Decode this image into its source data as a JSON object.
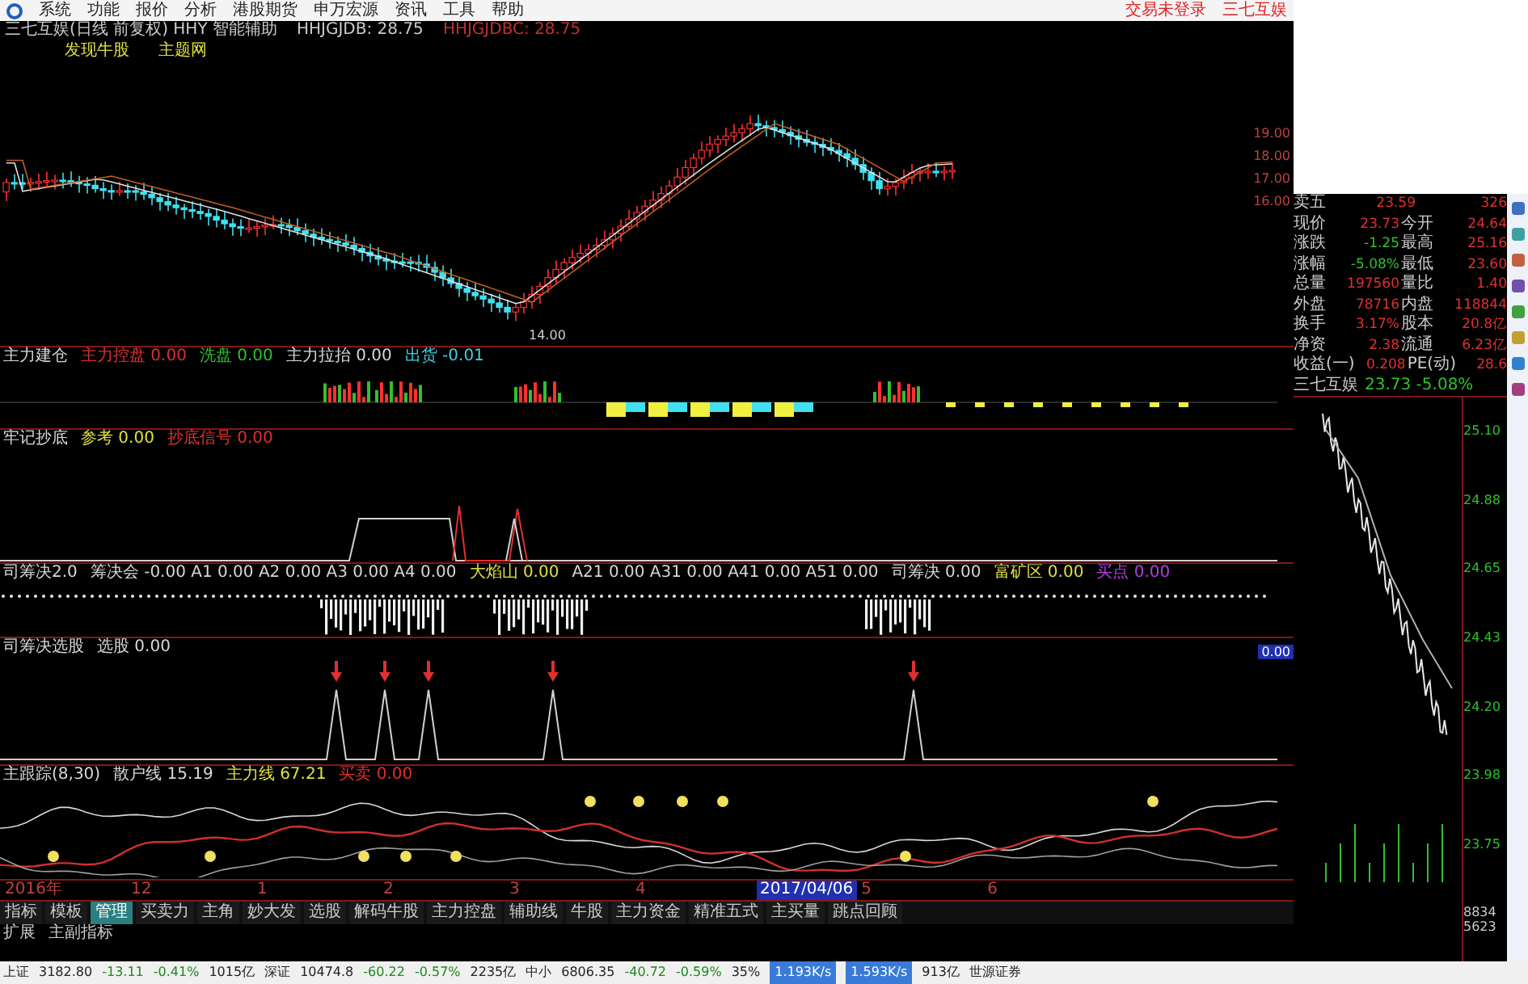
{
  "menu": {
    "items": [
      "系统",
      "功能",
      "报价",
      "分析",
      "港股期货",
      "申万宏源",
      "资讯",
      "工具",
      "帮助"
    ],
    "right_links": [
      "交易未登录",
      "三七互娱"
    ]
  },
  "chart_header": {
    "title": "三七互娱(日线 前复权) HHY 智能辅助",
    "indicator": "HHJGJDB: 28.75",
    "indicator_alt": "HHJGJDBC: 28.75"
  },
  "buttons": [
    "发现牛股",
    "主题网"
  ],
  "main_chart": {
    "low_label": "14.00",
    "price_labels": [
      "19.00",
      "18.00",
      "17.00",
      "16.00"
    ]
  },
  "panels": [
    {
      "labels": [
        {
          "text": "主力建仓",
          "color": "#d8d8d8"
        },
        {
          "text": "主力控盘 0.00",
          "color": "#e03030"
        },
        {
          "text": "洗盘 0.00",
          "color": "#30c030"
        },
        {
          "text": "主力拉抬 0.00",
          "color": "#d8d8d8"
        },
        {
          "text": "出货 -0.01",
          "color": "#40d0e0"
        }
      ]
    },
    {
      "labels": [
        {
          "text": "牢记抄底",
          "color": "#d8d8d8"
        },
        {
          "text": "参考 0.00",
          "color": "#e0e040"
        },
        {
          "text": "抄底信号 0.00",
          "color": "#e03030"
        }
      ]
    },
    {
      "labels": [
        {
          "text": "司筹决2.0",
          "color": "#d8d8d8"
        },
        {
          "text": "筹决会 -0.00 A1 0.00 A2 0.00 A3 0.00 A4 0.00",
          "color": "#d8d8d8"
        },
        {
          "text": "大焰山 0.00",
          "color": "#e0e040"
        },
        {
          "text": "A21 0.00 A31 0.00 A41 0.00 A51 0.00",
          "color": "#d8d8d8"
        },
        {
          "text": "司筹决 0.00",
          "color": "#d8d8d8"
        },
        {
          "text": "富矿区 0.00",
          "color": "#e0e040"
        },
        {
          "text": "买点 0.00",
          "color": "#b040e0"
        }
      ]
    },
    {
      "labels": [
        {
          "text": "司筹决选股",
          "color": "#d8d8d8"
        },
        {
          "text": "选股 0.00",
          "color": "#d8d8d8"
        }
      ]
    },
    {
      "labels": [
        {
          "text": "主跟踪(8,30)",
          "color": "#d8d8d8"
        },
        {
          "text": "散户线 15.19",
          "color": "#d8d8d8"
        },
        {
          "text": "主力线 67.21",
          "color": "#e0e040"
        },
        {
          "text": "买卖 0.00",
          "color": "#e03030"
        }
      ]
    }
  ],
  "side_badge": "0.00",
  "quote": {
    "rows": [
      {
        "label": "卖五",
        "value": "23.59",
        "value2": "326"
      },
      {
        "label": "现价",
        "value": "23.73",
        "label2": "今开",
        "value2": "24.64"
      },
      {
        "label": "涨跌",
        "value": "-1.25",
        "label2": "最高",
        "value2": "25.16"
      },
      {
        "label": "涨幅",
        "value": "-5.08%",
        "label2": "最低",
        "value2": "23.60"
      },
      {
        "label": "总量",
        "value": "197560",
        "label2": "量比",
        "value2": "1.40"
      },
      {
        "label": "外盘",
        "value": "78716",
        "label2": "内盘",
        "value2": "118844"
      },
      {
        "label": "换手",
        "value": "3.17%",
        "label2": "股本",
        "value2": "20.8亿"
      },
      {
        "label": "净资",
        "value": "2.38",
        "label2": "流通",
        "value2": "6.23亿"
      },
      {
        "label": "收益(一)",
        "value": "0.208",
        "label2": "PE(动)",
        "value2": "28.6"
      }
    ],
    "mini_title": "三七互娱",
    "mini_quote": "23.73 -5.08%"
  },
  "mini_chart": {
    "axis_labels": [
      "25.10",
      "24.88",
      "24.65",
      "24.43",
      "24.20",
      "23.98",
      "23.75"
    ],
    "volume_labels": [
      "8834",
      "5623"
    ]
  },
  "date_axis": {
    "labels": [
      "2016年",
      "12",
      "1",
      "2",
      "3",
      "4",
      "5",
      "6"
    ],
    "date_badge": "2017/04/06"
  },
  "tabs": [
    {
      "label": "指标",
      "selected": false
    },
    {
      "label": "模板",
      "selected": false
    },
    {
      "label": "管理",
      "selected": true
    },
    {
      "label": "买卖力",
      "selected": false
    },
    {
      "label": "主角",
      "selected": false
    },
    {
      "label": "妙大发",
      "selected": false
    },
    {
      "label": "选股",
      "selected": false
    },
    {
      "label": "解码牛股",
      "selected": false
    },
    {
      "label": "主力控盘",
      "selected": false
    },
    {
      "label": "辅助线",
      "selected": false
    },
    {
      "label": "牛股",
      "selected": false
    },
    {
      "label": "主力资金",
      "selected": false
    },
    {
      "label": "精准五式",
      "selected": false
    },
    {
      "label": "主买量",
      "selected": false
    },
    {
      "label": "跳点回顾",
      "selected": false
    }
  ],
  "sub_tabs": [
    "扩展",
    "主副指标"
  ],
  "status_bar": {
    "indices": [
      {
        "name": "上证",
        "value": "3182.80",
        "change": "-13.11",
        "pct": "-0.41%",
        "amount": "1015亿"
      },
      {
        "name": "深证",
        "value": "10474.8",
        "change": "-60.22",
        "pct": "-0.57%",
        "amount": "2235亿"
      },
      {
        "name": "中小",
        "value": "6806.35",
        "change": "-40.72",
        "pct": "-0.59%"
      }
    ],
    "speed": "35%",
    "down": "1.193K/s",
    "up": "1.593K/s",
    "amount": "913亿",
    "broker": "世源证券"
  }
}
